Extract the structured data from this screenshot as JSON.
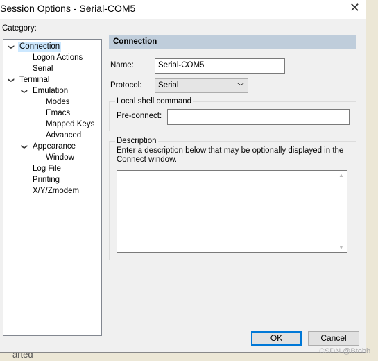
{
  "window": {
    "title": "Session Options - Serial-COM5",
    "close_icon": "close-icon"
  },
  "category_label": "Category:",
  "tree": [
    {
      "label": "Connection",
      "level": 0,
      "expanded": true,
      "selected": true
    },
    {
      "label": "Logon Actions",
      "level": 1
    },
    {
      "label": "Serial",
      "level": 1
    },
    {
      "label": "Terminal",
      "level": 0,
      "expanded": true
    },
    {
      "label": "Emulation",
      "level": 1,
      "expanded": true
    },
    {
      "label": "Modes",
      "level": 2
    },
    {
      "label": "Emacs",
      "level": 2
    },
    {
      "label": "Mapped Keys",
      "level": 2
    },
    {
      "label": "Advanced",
      "level": 2
    },
    {
      "label": "Appearance",
      "level": 1,
      "expanded": true
    },
    {
      "label": "Window",
      "level": 2
    },
    {
      "label": "Log File",
      "level": 1
    },
    {
      "label": "Printing",
      "level": 1
    },
    {
      "label": "X/Y/Zmodem",
      "level": 1
    }
  ],
  "panel": {
    "header": "Connection",
    "name_label": "Name:",
    "name_value": "Serial-COM5",
    "protocol_label": "Protocol:",
    "protocol_value": "Serial",
    "local_shell_group": "Local shell command",
    "preconnect_label": "Pre-connect:",
    "preconnect_value": "",
    "description_group": "Description",
    "description_hint": "Enter a description below that may be optionally displayed in the Connect window.",
    "description_value": ""
  },
  "buttons": {
    "ok": "OK",
    "cancel": "Cancel"
  },
  "watermark": "CSDN @Btobb",
  "background_text": "arted"
}
